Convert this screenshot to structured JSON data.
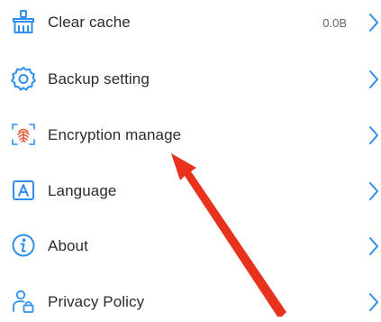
{
  "accent_color": "#2f8fea",
  "arrow_color": "#e8321d",
  "items": [
    {
      "label": "Clear cache",
      "value": "0.0B",
      "icon": "broom-icon"
    },
    {
      "label": "Backup setting",
      "value": "",
      "icon": "gear-icon"
    },
    {
      "label": "Encryption manage",
      "value": "",
      "icon": "fingerprint-icon"
    },
    {
      "label": "Language",
      "value": "",
      "icon": "language-icon"
    },
    {
      "label": "About",
      "value": "",
      "icon": "info-icon"
    },
    {
      "label": "Privacy Policy",
      "value": "",
      "icon": "privacy-lock-icon"
    }
  ]
}
